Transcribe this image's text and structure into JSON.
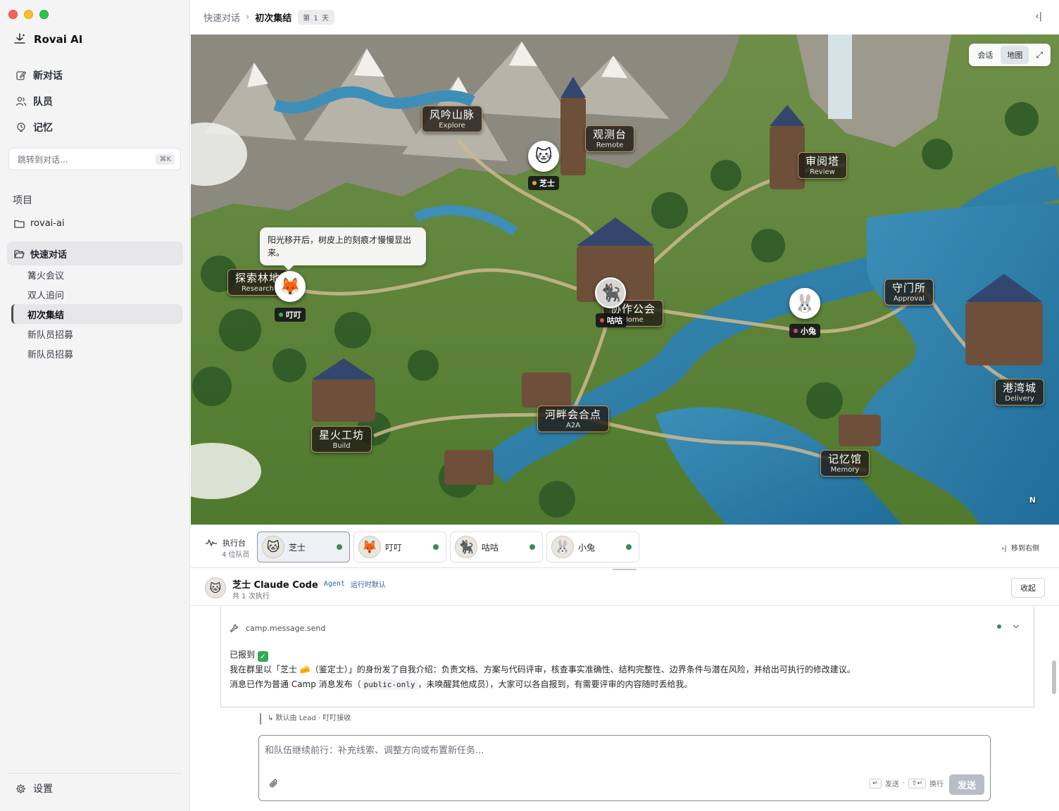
{
  "app": {
    "name": "Rovai AI"
  },
  "sidebar": {
    "nav": [
      {
        "label": "新对话",
        "icon": "edit-icon"
      },
      {
        "label": "队员",
        "icon": "users-icon"
      },
      {
        "label": "记忆",
        "icon": "memory-icon"
      }
    ],
    "jump": {
      "placeholder": "跳转到对话...",
      "shortcut": "⌘K"
    },
    "projects_title": "项目",
    "projects": [
      {
        "label": "rovai-ai"
      },
      {
        "label": "快速对话"
      }
    ],
    "conversations": [
      {
        "label": "篝火会议"
      },
      {
        "label": "双人追问"
      },
      {
        "label": "初次集结"
      },
      {
        "label": "新队员招募"
      },
      {
        "label": "新队员招募"
      }
    ],
    "settings_label": "设置"
  },
  "header": {
    "breadcrumb_parent": "快速对话",
    "breadcrumb_sep": "›",
    "breadcrumb_current": "初次集结",
    "day_badge": "第 1 天",
    "collapse_icon": "‹|"
  },
  "map": {
    "view_toggle": {
      "chat": "会话",
      "map": "地图",
      "expand": "⤢"
    },
    "locations": [
      {
        "name": "风吟山脉",
        "sub": "Explore"
      },
      {
        "name": "观测台",
        "sub": "Remote"
      },
      {
        "name": "审阅塔",
        "sub": "Review"
      },
      {
        "name": "探索林地",
        "sub": "Research"
      },
      {
        "name": "协作公会",
        "sub": "Home"
      },
      {
        "name": "守门所",
        "sub": "Approval"
      },
      {
        "name": "港湾城",
        "sub": "Delivery"
      },
      {
        "name": "河畔会合点",
        "sub": "A2A"
      },
      {
        "name": "星火工坊",
        "sub": "Build"
      },
      {
        "name": "记忆馆",
        "sub": "Memory"
      }
    ],
    "agents": [
      {
        "name": "芝士",
        "avatar": "🐱",
        "dot": "#e0a33a"
      },
      {
        "name": "叮叮",
        "avatar": "🦊",
        "dot": "#3fae5a"
      },
      {
        "name": "咕咕",
        "avatar": "🐈‍⬛",
        "dot": "#e0534a"
      },
      {
        "name": "小兔",
        "avatar": "🐰",
        "dot": "#c24a8a"
      }
    ],
    "speech": "阳光移开后，树皮上的刻痕才慢慢显出来。",
    "compass": "N",
    "bottom_label": "港湾城"
  },
  "exec": {
    "title": "执行台",
    "count": "4 位队员",
    "members": [
      {
        "name": "芝士",
        "avatar": "🐱"
      },
      {
        "name": "叮叮",
        "avatar": "🦊"
      },
      {
        "name": "咕咕",
        "avatar": "🐈‍⬛"
      },
      {
        "name": "小兔",
        "avatar": "🐰"
      }
    ],
    "move_right": "移到右侧",
    "status_color": "#3a8a5a"
  },
  "detail": {
    "name": "芝士 Claude Code",
    "badge": "Agent",
    "runtime": "运行时默认",
    "runs": "共 1 次执行",
    "fold": "收起",
    "tool": "camp.message.send",
    "line1": "已报到",
    "line1_check": "✓",
    "line2": "我在群里以「芝士 🧀（鉴定士）」的身份发了自我介绍：负责文档、方案与代码评审，核查事实准确性、结构完整性、边界条件与潜在风险，并给出可执行的修改建议。",
    "line3_pre": "消息已作为普通 Camp 消息发布（",
    "line3_code": "public-only",
    "line3_post": "，未唤醒其他成员），大家可以各自报到，有需要评审的内容随时丢给我。"
  },
  "routing": "↳ 默认由 Lead · 叮叮接收",
  "composer": {
    "placeholder": "和队伍继续前行：补充线索、调整方向或布置新任务...",
    "hint_send_key": "↵",
    "hint_send": "发送",
    "hint_newline_key": "⇧↵",
    "hint_newline": "换行",
    "send": "发送"
  }
}
